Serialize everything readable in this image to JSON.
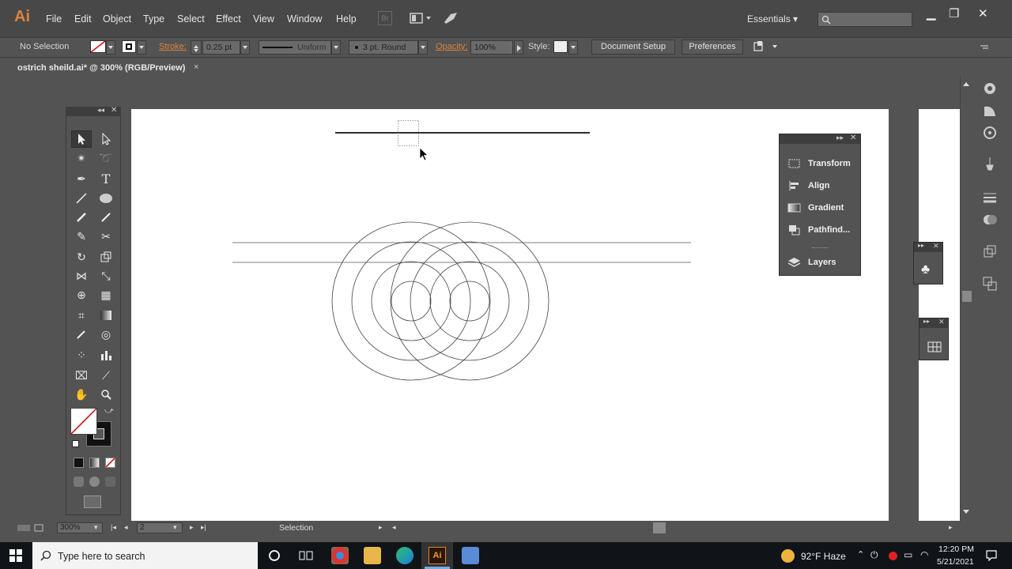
{
  "app": {
    "logo": "Ai",
    "menu": [
      "File",
      "Edit",
      "Object",
      "Type",
      "Select",
      "Effect",
      "View",
      "Window",
      "Help"
    ],
    "bridge_label": "Br",
    "workspace": "Essentials"
  },
  "control_bar": {
    "selection": "No Selection",
    "stroke_label": "Stroke:",
    "stroke_value": "0.25 pt",
    "profile": "Uniform",
    "brush": "3 pt. Round",
    "opacity_label": "Opacity:",
    "opacity_value": "100%",
    "style_label": "Style:",
    "doc_setup": "Document Setup",
    "preferences": "Preferences"
  },
  "document": {
    "tab_title": "ostrich sheild.ai* @ 300% (RGB/Preview)",
    "close": "×"
  },
  "floating_panel": {
    "items": [
      "Transform",
      "Align",
      "Gradient",
      "Pathfind...",
      "Layers"
    ]
  },
  "status": {
    "zoom": "300%",
    "page": "2",
    "tool": "Selection"
  },
  "taskbar": {
    "search_placeholder": "Type here to search",
    "weather": "92°F  Haze",
    "time": "12:20 PM",
    "date": "5/21/2021"
  },
  "colors": {
    "brand": "#d9843e",
    "stroke_orange": "#d9843e"
  }
}
